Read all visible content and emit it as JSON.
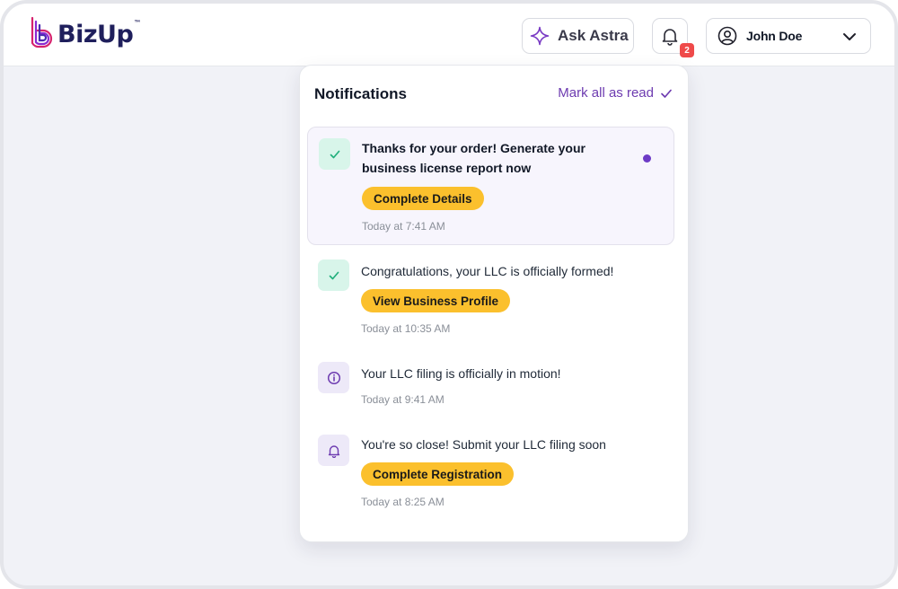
{
  "header": {
    "logo_text": "BizUp",
    "logo_tm": "™",
    "ask_label": "Ask Astra",
    "ask_icon": "sparkle-icon",
    "bell_icon": "bell-icon",
    "bell_badge": "2",
    "user_icon": "user-circle-icon",
    "user_name": "John Doe",
    "user_chevron": "chevron-down-icon"
  },
  "notifications_panel": {
    "title": "Notifications",
    "mark_all_label": "Mark all as read",
    "mark_all_icon": "check-icon",
    "items": [
      {
        "icon": "check-icon",
        "text": "Thanks for your order! Generate your business license report now",
        "action": "Complete Details",
        "time": "Today at 7:41 AM",
        "unread": true
      },
      {
        "icon": "check-icon",
        "text": "Congratulations, your LLC is officially formed!",
        "action": "View Business Profile",
        "time": "Today at 10:35 AM",
        "unread": false
      },
      {
        "icon": "info-icon",
        "text": "Your LLC filing is officially in motion!",
        "time": "Today at 9:41 AM",
        "unread": false
      },
      {
        "icon": "bell-icon",
        "text": "You're so close! Submit your LLC filing soon",
        "action": "Complete Registration",
        "time": "Today at 8:25 AM",
        "unread": false
      }
    ]
  },
  "colors": {
    "brand_purple": "#6d3bb0",
    "action_yellow": "#fbc02d",
    "success_green": "#22b07d",
    "badge_red": "#ef4a4a"
  }
}
